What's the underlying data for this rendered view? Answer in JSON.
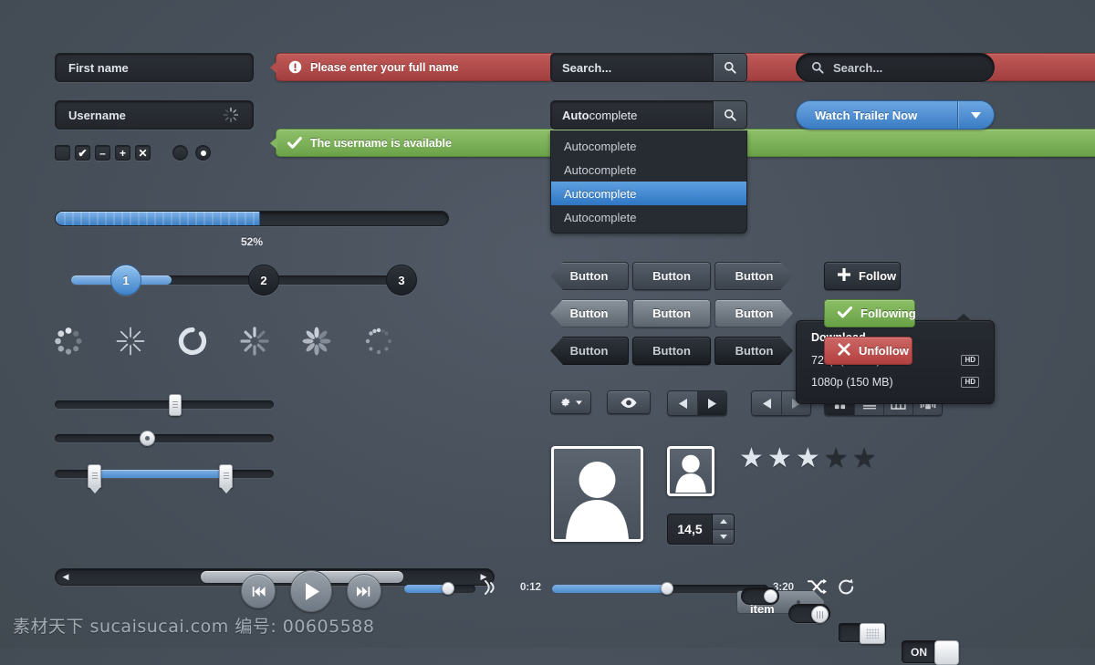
{
  "form": {
    "first_name_placeholder": "First name",
    "username_placeholder": "Username",
    "error_message": "Please enter your full name",
    "success_message": "The username is available",
    "error_icon": "exclamation-circle-icon",
    "success_icon": "check-icon",
    "checkboxes": [
      {
        "name": "checkbox-empty",
        "glyph": ""
      },
      {
        "name": "checkbox-checked",
        "glyph": "✔"
      },
      {
        "name": "checkbox-minus",
        "glyph": "–"
      },
      {
        "name": "checkbox-plus",
        "glyph": "+"
      },
      {
        "name": "checkbox-cross",
        "glyph": "✕"
      }
    ],
    "radios": [
      {
        "name": "radio-empty",
        "selected": false
      },
      {
        "name": "radio-selected",
        "selected": true
      }
    ]
  },
  "progress": {
    "percent_label": "52%",
    "percent_value": 52
  },
  "steps": {
    "items": [
      "1",
      "2",
      "3"
    ],
    "active_index": 0
  },
  "spinners": [
    "spinner-dots",
    "spinner-spokes-thin",
    "spinner-arc",
    "spinner-spokes",
    "spinner-petals",
    "spinner-dots-small"
  ],
  "sliders": [
    {
      "name": "slider-rect-handle",
      "value": 55,
      "type": "single"
    },
    {
      "name": "slider-round-handle",
      "value": 42,
      "type": "single"
    },
    {
      "name": "slider-range",
      "from": 18,
      "to": 78,
      "type": "range"
    }
  ],
  "scrollbar": {
    "left_arrow": "◀",
    "right_arrow": "▶",
    "thumb_start": 33,
    "thumb_width": 46
  },
  "player_left": {
    "prev_icon": "skip-back-icon",
    "play_icon": "play-icon",
    "next_icon": "skip-forward-icon",
    "volume_value": 62,
    "volume_icon": "volume-waves-icon"
  },
  "player_bottom": {
    "time_current": "0:12",
    "time_total": "3:20",
    "progress_value": 53,
    "shuffle_icon": "shuffle-icon",
    "repeat_icon": "repeat-icon"
  },
  "search_middle": {
    "placeholder": "Search...",
    "button_icon": "search-icon"
  },
  "autocomplete": {
    "value_bold": "Auto",
    "value_rest": "complete",
    "button_icon": "search-icon",
    "options": [
      "Autocomplete",
      "Autocomplete",
      "Autocomplete",
      "Autocomplete"
    ],
    "selected_index": 2
  },
  "search_right": {
    "placeholder": "Search...",
    "icon": "search-icon"
  },
  "trailer": {
    "label": "Watch Trailer Now",
    "caret_icon": "chevron-down-icon"
  },
  "download_panel": {
    "title": "Download",
    "items": [
      {
        "label": "720p (88 MB)",
        "badge": "HD"
      },
      {
        "label": "1080p (150 MB)",
        "badge": "HD"
      }
    ]
  },
  "buttons_grid": {
    "label": "Button",
    "rows": [
      [
        {
          "style": "dark",
          "shape": "notch"
        },
        {
          "style": "dark",
          "shape": "flat"
        },
        {
          "style": "dark",
          "shape": "arrow"
        }
      ],
      [
        {
          "style": "light",
          "shape": "notch"
        },
        {
          "style": "light",
          "shape": "flat"
        },
        {
          "style": "light",
          "shape": "arrow"
        }
      ],
      [
        {
          "style": "black",
          "shape": "notch"
        },
        {
          "style": "black",
          "shape": "flat"
        },
        {
          "style": "black",
          "shape": "arrow"
        }
      ]
    ]
  },
  "follow_buttons": [
    {
      "label": "Follow",
      "style": "neutral",
      "icon": "plus-icon",
      "glyph": "✚"
    },
    {
      "label": "Following",
      "style": "green",
      "icon": "check-icon",
      "glyph": "✔"
    },
    {
      "label": "Unfollow",
      "style": "red",
      "icon": "cross-icon",
      "glyph": "✖"
    }
  ],
  "toolbar": {
    "gear_icon": "gear-icon",
    "gear_caret_icon": "caret-down-icon",
    "eye_icon": "eye-icon",
    "nav_prev_icon": "triangle-left-icon",
    "nav_next_icon": "triangle-right-icon",
    "view_modes": [
      {
        "name": "view-grid-icon",
        "active": true
      },
      {
        "name": "view-list-icon",
        "active": false
      },
      {
        "name": "view-columns-icon",
        "active": false
      },
      {
        "name": "view-coverflow-icon",
        "active": false
      }
    ]
  },
  "avatars": [
    {
      "name": "avatar-large",
      "icon": "user-silhouette-icon"
    },
    {
      "name": "avatar-small",
      "icon": "user-silhouette-icon"
    }
  ],
  "stepper": {
    "value": "14,5",
    "up_icon": "caret-up-icon",
    "down_icon": "caret-down-icon"
  },
  "tag": {
    "label": "Tag item"
  },
  "rating": {
    "total": 5,
    "filled": 3,
    "star_glyph": "★"
  },
  "toggles": [
    {
      "name": "toggle-pill-small",
      "on": true,
      "label": ""
    },
    {
      "name": "toggle-pill-grip",
      "on": true,
      "label": ""
    },
    {
      "name": "toggle-square-dotted",
      "on": true,
      "label": ""
    },
    {
      "name": "toggle-on-off",
      "on": true,
      "label": "ON"
    }
  ],
  "watermark": {
    "text": "素材天下 sucaisucai.com  编号: 00605588"
  },
  "colors": {
    "background": "#4b535e",
    "accent_blue": "#4d8ccd",
    "success_green": "#6ba349",
    "error_red": "#a33f3f",
    "field_dark": "#23272d"
  }
}
